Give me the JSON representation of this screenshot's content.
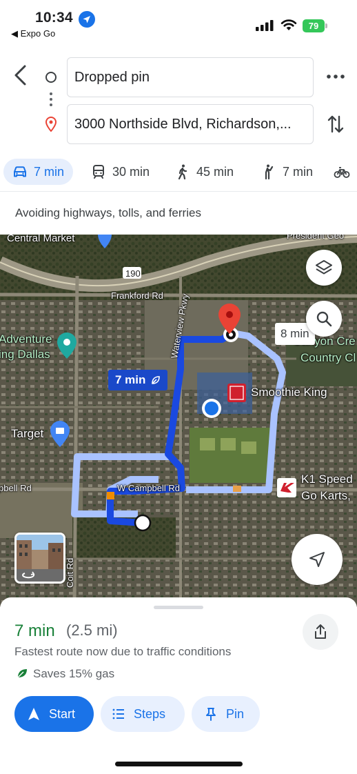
{
  "status_bar": {
    "time": "10:34",
    "back_app": "◀ Expo Go",
    "battery": "79"
  },
  "directions": {
    "origin": "Dropped pin",
    "destination": "3000 Northside Blvd, Richardson,..."
  },
  "modes": [
    {
      "icon": "car-icon",
      "label": "7 min",
      "active": true
    },
    {
      "icon": "transit-icon",
      "label": "30 min"
    },
    {
      "icon": "walk-icon",
      "label": "45 min"
    },
    {
      "icon": "ride-icon",
      "label": "7 min"
    },
    {
      "icon": "bike-icon",
      "label": ""
    }
  ],
  "route_options_note": "Avoiding highways, tolls, and ferries",
  "map": {
    "labels": {
      "central_market": "Central Market",
      "president": "President Geo",
      "highway_190": "190",
      "frankford_rd": "Frankford Rd",
      "waterview_pkwy": "Waterview Pkwy",
      "adventure_1": "Adventure",
      "adventure_2": "ing Dallas",
      "canyon_1": "Canyon Cre",
      "canyon_2": "Country Cl",
      "smoothie_king": "Smoothie King",
      "target": "Target",
      "campbell_left": "pbell Rd",
      "w_campbell_rd": "W Campbell Rd",
      "k1_1": "K1 Speed",
      "k1_2": "Go Karts,",
      "coit_rd": "Coit Rd"
    },
    "route_callout": "7 min",
    "alt_route_callout": "8 min",
    "colors": {
      "route": "#1a49e0",
      "alt_route": "#a9c2ff",
      "destination_pin": "#ea4335"
    }
  },
  "sheet": {
    "duration": "7 min",
    "distance": "(2.5 mi)",
    "summary": "Fastest route now due to traffic conditions",
    "gas_savings": "Saves 15% gas",
    "start_label": "Start",
    "steps_label": "Steps",
    "pin_label": "Pin"
  }
}
